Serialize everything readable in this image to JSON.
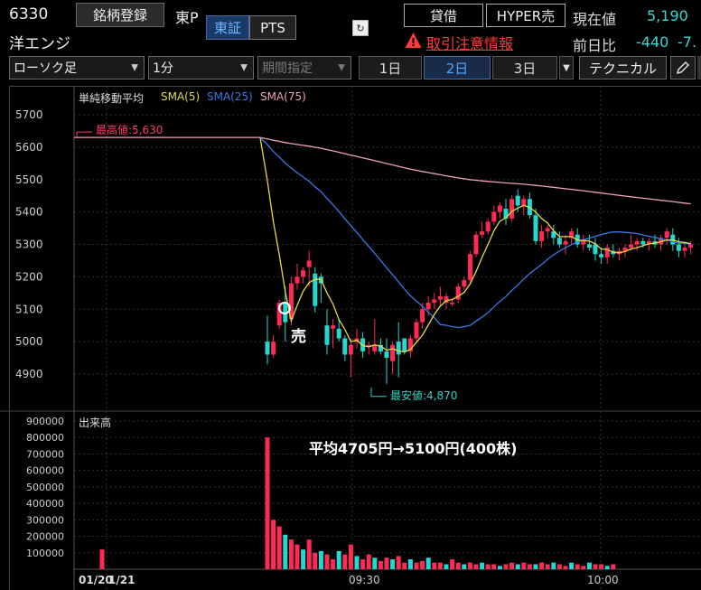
{
  "stock": {
    "code": "6330",
    "name": "洋エンジ",
    "register_label": "銘柄登録",
    "market_prefix": "東P",
    "exchange_tabs": [
      "東証",
      "PTS"
    ],
    "active_exchange": "東証",
    "icon_glyph": "↻",
    "lend_label": "貸借",
    "hyper_label": "HYPER売",
    "warning_label": "取引注意情報",
    "price_label": "現在値",
    "price": "5,190",
    "change_label": "前日比",
    "change": "-440",
    "change_pct": "-7."
  },
  "toolbar": {
    "chart_type": "ローソク足",
    "interval": "1分",
    "period": "期間指定",
    "ranges": [
      "1日",
      "2日",
      "3日"
    ],
    "active_range": "2日",
    "technical_label": "テクニカル",
    "pen_icon": "pencil-icon"
  },
  "legend": {
    "title": "単純移動平均",
    "sma5": "SMA(5)",
    "sma25": "SMA(25)",
    "sma75": "SMA(75)"
  },
  "colors": {
    "up": "#ff2a55",
    "down": "#24d8d0",
    "sma5": "#e6dc3c",
    "sma25": "#3a78e6",
    "sma75": "#f0a0c0",
    "high_label": "#ff3a6a",
    "low_label": "#30d0c8"
  },
  "annotations": {
    "high": "最高値:5,630",
    "low": "最安値:4,870",
    "sell": "売",
    "average": "平均4705円→5100円(400株)"
  },
  "volume": {
    "label": "出来高"
  },
  "chart_data": {
    "type": "candlestick",
    "price_axis": {
      "ticks": [
        5700,
        5600,
        5500,
        5400,
        5300,
        5200,
        5100,
        5000,
        4900
      ],
      "range": [
        4840,
        5730
      ]
    },
    "volume_axis": {
      "ticks": [
        "900000",
        "800000",
        "700000",
        "600000",
        "500000",
        "400000",
        "300000",
        "200000",
        "100000"
      ],
      "range": [
        0,
        900000
      ]
    },
    "x_labels": [
      "01/20",
      "1/21",
      "09:30",
      "10:00"
    ],
    "prev_day_close": 5630,
    "candles": [
      [
        5000,
        5080,
        4930,
        4960
      ],
      [
        4960,
        5020,
        4950,
        5000
      ],
      [
        5050,
        5130,
        5040,
        5120
      ],
      [
        5120,
        5170,
        5000,
        5060
      ],
      [
        5070,
        5200,
        5050,
        5180
      ],
      [
        5180,
        5240,
        5160,
        5200
      ],
      [
        5200,
        5230,
        5180,
        5220
      ],
      [
        5230,
        5280,
        5170,
        5250
      ],
      [
        5210,
        5230,
        5090,
        5110
      ],
      [
        5200,
        5210,
        5120,
        5180
      ],
      [
        5050,
        5100,
        4960,
        4990
      ],
      [
        5040,
        5070,
        4980,
        5050
      ],
      [
        5040,
        5070,
        5000,
        5010
      ],
      [
        5010,
        5020,
        4940,
        4960
      ],
      [
        4960,
        5010,
        4890,
        4990
      ],
      [
        5000,
        5040,
        4980,
        5010
      ],
      [
        5010,
        5030,
        4950,
        4970
      ],
      [
        4990,
        5000,
        4960,
        4990
      ],
      [
        4970,
        5070,
        4960,
        4990
      ],
      [
        4990,
        5010,
        4960,
        4970
      ],
      [
        4970,
        5010,
        4870,
        4950
      ],
      [
        4940,
        5000,
        4900,
        4990
      ],
      [
        5000,
        5060,
        4890,
        4960
      ],
      [
        5010,
        5010,
        4960,
        4970
      ],
      [
        4970,
        5020,
        4950,
        5010
      ],
      [
        5010,
        5070,
        5000,
        5060
      ],
      [
        5060,
        5120,
        5040,
        5100
      ],
      [
        5100,
        5140,
        5080,
        5120
      ],
      [
        5120,
        5150,
        5100,
        5130
      ],
      [
        5130,
        5170,
        5110,
        5140
      ],
      [
        5120,
        5150,
        5100,
        5140
      ],
      [
        5120,
        5130,
        5110,
        5120
      ],
      [
        5130,
        5180,
        5120,
        5170
      ],
      [
        5170,
        5200,
        5160,
        5190
      ],
      [
        5190,
        5280,
        5180,
        5270
      ],
      [
        5270,
        5340,
        5260,
        5330
      ],
      [
        5330,
        5370,
        5320,
        5340
      ],
      [
        5340,
        5380,
        5330,
        5370
      ],
      [
        5370,
        5420,
        5360,
        5400
      ],
      [
        5400,
        5430,
        5380,
        5420
      ],
      [
        5410,
        5440,
        5360,
        5380
      ],
      [
        5380,
        5450,
        5370,
        5440
      ],
      [
        5450,
        5470,
        5400,
        5420
      ],
      [
        5420,
        5450,
        5390,
        5440
      ],
      [
        5440,
        5460,
        5380,
        5390
      ],
      [
        5390,
        5410,
        5300,
        5310
      ],
      [
        5310,
        5360,
        5290,
        5340
      ],
      [
        5340,
        5360,
        5320,
        5350
      ],
      [
        5340,
        5360,
        5300,
        5320
      ],
      [
        5320,
        5340,
        5290,
        5300
      ],
      [
        5300,
        5330,
        5270,
        5310
      ],
      [
        5320,
        5350,
        5300,
        5340
      ],
      [
        5330,
        5350,
        5290,
        5300
      ],
      [
        5300,
        5330,
        5280,
        5310
      ],
      [
        5300,
        5330,
        5280,
        5290
      ],
      [
        5300,
        5320,
        5250,
        5270
      ],
      [
        5270,
        5290,
        5240,
        5260
      ],
      [
        5260,
        5300,
        5240,
        5290
      ],
      [
        5280,
        5300,
        5260,
        5270
      ],
      [
        5270,
        5290,
        5250,
        5280
      ],
      [
        5280,
        5300,
        5260,
        5290
      ],
      [
        5290,
        5330,
        5280,
        5300
      ],
      [
        5300,
        5320,
        5280,
        5310
      ],
      [
        5310,
        5320,
        5290,
        5300
      ],
      [
        5300,
        5320,
        5280,
        5310
      ],
      [
        5310,
        5330,
        5290,
        5300
      ],
      [
        5300,
        5330,
        5280,
        5320
      ],
      [
        5320,
        5350,
        5300,
        5340
      ],
      [
        5330,
        5350,
        5280,
        5300
      ],
      [
        5300,
        5320,
        5260,
        5280
      ],
      [
        5280,
        5300,
        5260,
        5290
      ],
      [
        5290,
        5310,
        5270,
        5300
      ]
    ],
    "volumes": [
      120000,
      0,
      0,
      0,
      0,
      0,
      0,
      0,
      0,
      0,
      0,
      0,
      0,
      0,
      0,
      0,
      0,
      0,
      0,
      0,
      0,
      800000,
      300000,
      260000,
      210000,
      180000,
      150000,
      120000,
      180000,
      100000,
      110000,
      90000,
      60000,
      110000,
      90000,
      150000,
      80000,
      60000,
      90000,
      70000,
      50000,
      70000,
      60000,
      80000,
      40000,
      60000,
      40000,
      50000,
      70000,
      40000,
      40000,
      30000,
      60000,
      40000,
      30000,
      40000,
      30000,
      40000,
      30000,
      30000,
      20000,
      30000,
      40000,
      30000,
      40000,
      30000,
      30000,
      40000,
      30000,
      40000,
      30000,
      20000,
      40000,
      30000,
      20000,
      40000,
      30000,
      30000,
      20000,
      30000
    ]
  }
}
